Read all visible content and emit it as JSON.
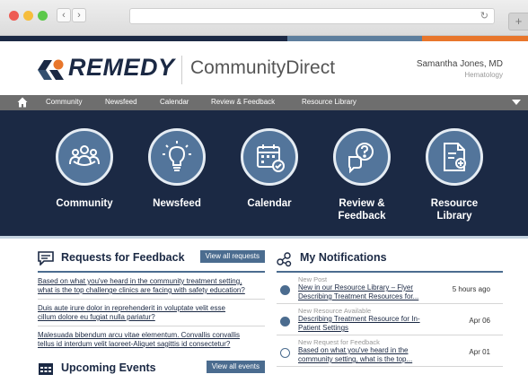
{
  "browser": {
    "back_glyph": "‹",
    "forward_glyph": "›",
    "reload_glyph": "↻",
    "new_tab_glyph": "+"
  },
  "colors": {
    "navy": "#1b2944",
    "steel": "#4b6c8f",
    "orange": "#e8762b",
    "gray_nav": "#6e6e6e"
  },
  "header": {
    "brand": "REMEDY",
    "product": "CommunityDirect",
    "user_name": "Samantha Jones, MD",
    "user_role": "Hematology"
  },
  "nav": {
    "items": [
      "Community",
      "Newsfeed",
      "Calendar",
      "Review & Feedback",
      "Resource Library"
    ]
  },
  "tiles": [
    {
      "label_1": "Community",
      "label_2": "",
      "icon": "people-icon"
    },
    {
      "label_1": "Newsfeed",
      "label_2": "",
      "icon": "lightbulb-icon"
    },
    {
      "label_1": "Calendar",
      "label_2": "",
      "icon": "calendar-icon"
    },
    {
      "label_1": "Review &",
      "label_2": "Feedback",
      "icon": "chat-question-icon"
    },
    {
      "label_1": "Resource",
      "label_2": "Library",
      "icon": "document-icon"
    }
  ],
  "requests": {
    "title": "Requests for Feedback",
    "view_all": "View all requests",
    "items": [
      {
        "line_1": "Based on what you've heard in the community treatment setting,",
        "line_2": "what is the top challenge clinics are facing with safety education?"
      },
      {
        "line_1": "Duis aute irure dolor in reprehenderit in voluptate velit esse",
        "line_2": "cillum dolore eu fugiat nulla pariatur?"
      },
      {
        "line_1": "Malesuada bibendum arcu vitae elementum. Convallis convallis",
        "line_2": "tellus id interdum velit laoreet-Aliquet sagittis id consectetur?"
      }
    ]
  },
  "events": {
    "title": "Upcoming Events",
    "view_all": "View all events"
  },
  "notifications": {
    "title": "My Notifications",
    "items": [
      {
        "type": "New Post",
        "line_1": "New in our Resource Library – Flyer",
        "line_2": "Describing Treatment Resources for...",
        "time": "5 hours ago",
        "hollow": false
      },
      {
        "type": "New Resource Available",
        "line_1": "Describing Treatment Resource for In-",
        "line_2": "Patient Settings",
        "time": "Apr 06",
        "hollow": false
      },
      {
        "type": "New Request for Feedback",
        "line_1": "Based on what you've heard in the",
        "line_2": "community setting, what is the top...",
        "time": "Apr 01",
        "hollow": true
      }
    ]
  }
}
